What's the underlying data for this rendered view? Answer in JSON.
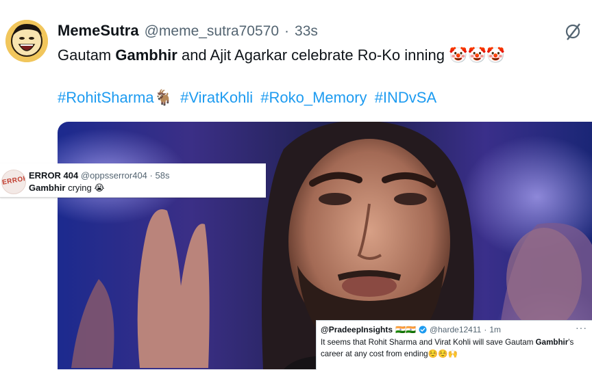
{
  "post": {
    "display_name": "MemeSutra",
    "handle": "@meme_sutra70570",
    "separator": "·",
    "time": "33s",
    "text_before": "Gautam ",
    "text_bold": "Gambhir",
    "text_after": " and Ajit Agarkar celebrate Ro-Ko inning 🤡🤡🤡",
    "hashtags": [
      "#RohitSharma🐐",
      "#ViratKohli",
      "#Roko_Memory",
      "#INDvSA"
    ]
  },
  "reply_card_1": {
    "display_name": "ERROR 404",
    "handle": "@oppsserror404",
    "separator": "·",
    "time": "58s",
    "avatar_text": "ERROR",
    "text_bold": "Gambhir",
    "text_after": " crying 😭"
  },
  "reply_card_2": {
    "display_name": "@PradeepInsights",
    "flags": "🇮🇳🇮🇳",
    "handle": "@harde12411",
    "separator": "·",
    "time": "1m",
    "more": "···",
    "text_before": "It seems that Rohit Sharma and Virat Kohli will save Gautam ",
    "text_bold": "Gambhir",
    "text_after": "'s career at any cost from ending☺️☺️🙌"
  },
  "icons": {
    "grok": "grok-icon",
    "verified": "verified-badge-icon"
  },
  "colors": {
    "link": "#1d9bf0",
    "secondary_text": "#536471",
    "verified": "#1d9bf0"
  }
}
